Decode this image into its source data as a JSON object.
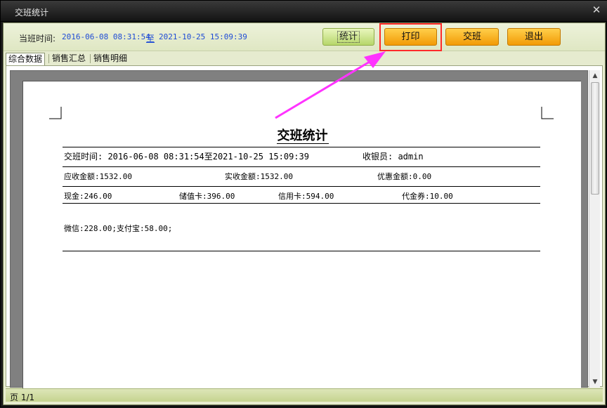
{
  "window": {
    "title": "交班统计",
    "close_glyph": "✕"
  },
  "toolbar": {
    "time_label": "当班时间:",
    "time_from": "2016-06-08 08:31:54",
    "time_sep": "至",
    "time_to": "2021-10-25 15:09:39",
    "btn_stat": "统计",
    "btn_print": "打印",
    "btn_handover": "交班",
    "btn_exit": "退出"
  },
  "tabs": [
    {
      "label": "综合数据",
      "active": true
    },
    {
      "label": "销售汇总",
      "active": false
    },
    {
      "label": "销售明细",
      "active": false
    }
  ],
  "report": {
    "title": "交班统计",
    "row1": {
      "shift_time": "交班时间: 2016-06-08 08:31:54至2021-10-25 15:09:39",
      "cashier": "收银员: admin"
    },
    "row2": {
      "receivable": "应收金额:1532.00",
      "received": "实收金额:1532.00",
      "discount": "优惠金额:0.00"
    },
    "row3": {
      "cash": "现金:246.00",
      "stored_card": "储值卡:396.00",
      "credit_card": "信用卡:594.00",
      "voucher": "代金券:10.00"
    },
    "row4": {
      "other": "微信:228.00;支付宝:58.00;"
    }
  },
  "status": {
    "page": "页 1/1"
  },
  "colors": {
    "accent_orange": "#f7a21b",
    "highlight_red": "#ff2a2a",
    "arrow_magenta": "#ff33ff",
    "link_blue": "#1e4bd6"
  },
  "icons": {
    "close": "close-icon",
    "scroll_up": "arrow-up-icon",
    "scroll_down": "arrow-down-icon"
  }
}
